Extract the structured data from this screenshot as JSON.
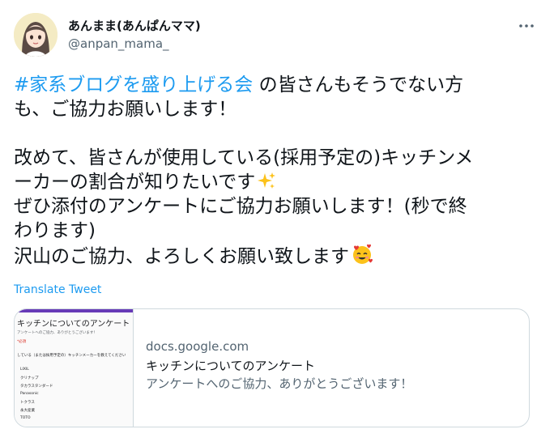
{
  "author": {
    "display_name": "あんままあんぱんママ)",
    "display_name_full": "あんまま(あんぱんママ)",
    "handle": "@anpan_mama_"
  },
  "tweet": {
    "hashtag": "#家系ブログを盛り上げる会",
    "line1_rest": " の皆さんもそうでない方",
    "line2": "も、ご協力お願いします！",
    "line3": "改めて、皆さんが使用している(採用予定の)キッチンメ",
    "line4": "ーカーの割合が知りたいです",
    "line5": "ぜひ添付のアンケートにご協力お願いします！(秒で終",
    "line6": "わります)",
    "line7": "沢山のご協力、よろしくお願い致します",
    "emoji_sparkles": "sparkles-icon",
    "emoji_smiling_hearts": "smiling-face-with-hearts-icon"
  },
  "translate_label": "Translate Tweet",
  "card": {
    "domain": "docs.google.com",
    "title": "キッチンについてのアンケート",
    "description": "アンケートへのご協力、ありがとうございます！",
    "thumbnail": {
      "title": "キッチンについてのアンケート",
      "subtitle": "アンケートへのご協力、ありがとうございます！",
      "required_note": "*必須",
      "question": "している（または採用予定の）キッチンメーカーを教えてください",
      "options": [
        "LIXIL",
        "クリナップ",
        "タカラスタンダード",
        "Panasonic",
        "トクラス",
        "永大産業",
        "TOTO"
      ]
    }
  },
  "colors": {
    "link": "#1d9bf0",
    "text": "#0f1419",
    "secondary": "#536471",
    "border": "#cfd9de",
    "forms_accent": "#673ab7"
  }
}
